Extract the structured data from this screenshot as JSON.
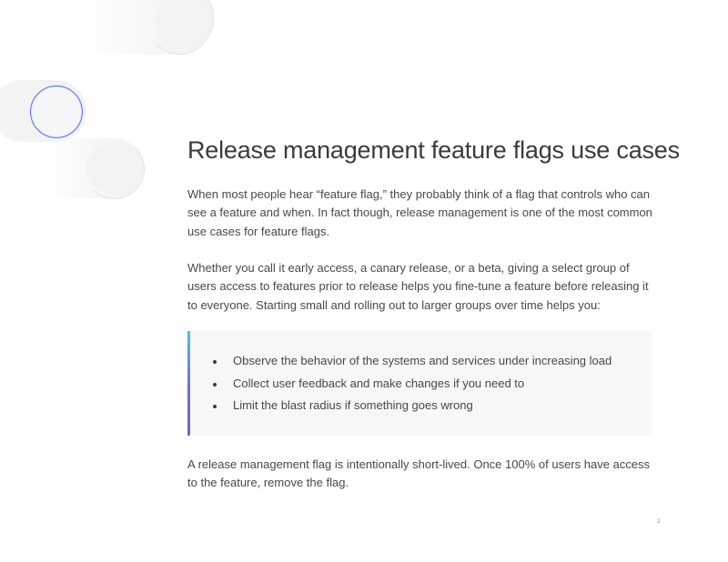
{
  "heading": "Release management feature flags use cases",
  "paragraphs": [
    "When most people hear “feature flag,” they probably think of a flag that controls who can see a feature and when. In fact though, release management is one of the most common use cases for feature flags.",
    "Whether you call it early access, a canary release, or a beta, giving a select group of users access to features prior to release helps you fine-tune a feature before releasing it to everyone. Starting small and rolling out to larger groups over time helps you:",
    "A release management flag is intentionally short-lived. Once 100% of users have access to the feature, remove the flag."
  ],
  "callout": {
    "items": [
      "Observe the behavior of the systems and services under increasing load",
      "Collect user feedback and make changes if you need to",
      "Limit the blast radius if something goes wrong"
    ],
    "accent_colors": [
      "#55bde6",
      "#7b5fd0"
    ]
  },
  "page_number": "2"
}
